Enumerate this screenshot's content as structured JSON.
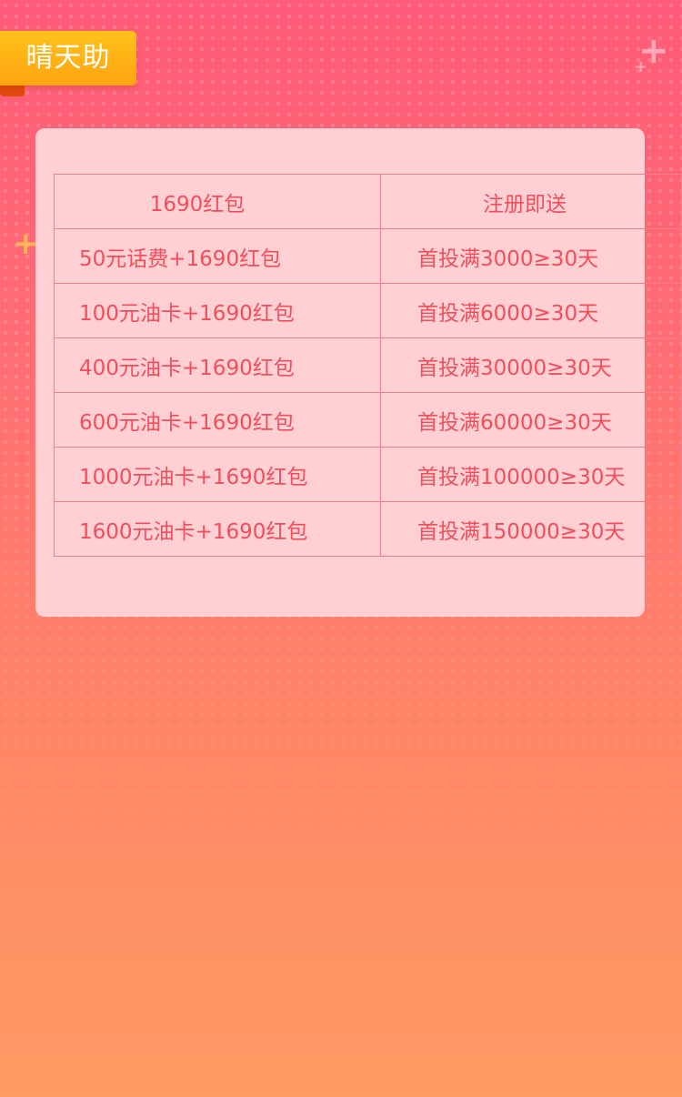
{
  "badge": {
    "label": "晴天助"
  },
  "table": {
    "headers": [
      "1690红包",
      "注册即送"
    ],
    "rows": [
      [
        "50元话费+1690红包",
        "首投满3000≥30天"
      ],
      [
        "100元油卡+1690红包",
        "首投满6000≥30天"
      ],
      [
        "400元油卡+1690红包",
        "首投满30000≥30天"
      ],
      [
        "600元油卡+1690红包",
        "首投满60000≥30天"
      ],
      [
        "1000元油卡+1690红包",
        "首投满100000≥30天"
      ],
      [
        "1600元油卡+1690红包",
        "首投满150000≥30天"
      ]
    ]
  },
  "colors": {
    "background_top": "#ff5a78",
    "background_bottom": "#ff9b63",
    "badge": "#ffb015",
    "card": "#ffd0d3",
    "table_text": "#f14e5c",
    "table_border": "#f07f8a"
  },
  "icons": [
    "plus-sparkle-icon",
    "plus-sparkle-icon",
    "plus-sparkle-icon"
  ]
}
